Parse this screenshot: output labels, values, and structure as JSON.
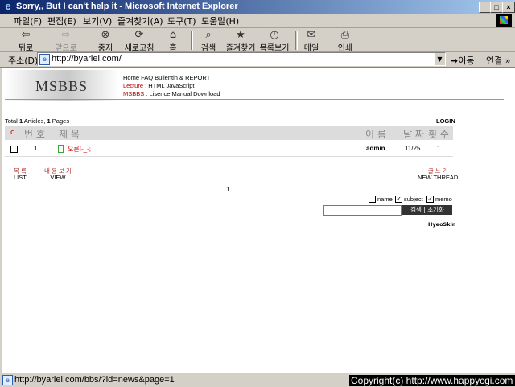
{
  "window": {
    "title": "Sorry,, But I can't help it - Microsoft Internet Explorer",
    "minimize": "_",
    "maximize": "□",
    "close": "×"
  },
  "menu": [
    "파일(F)",
    "편집(E)",
    "보기(V)",
    "즐겨찾기(A)",
    "도구(T)",
    "도움말(H)"
  ],
  "toolbar": {
    "back": "뒤로",
    "forward": "앞으로",
    "stop": "중지",
    "refresh": "새로고침",
    "home": "홈",
    "search": "검색",
    "favorites": "즐겨찾기",
    "history": "목록보기",
    "mail": "메일",
    "print": "인쇄"
  },
  "address": {
    "label": "주소(D)",
    "url": "http://byariel.com/",
    "go": "이동",
    "links": "연결 »"
  },
  "page": {
    "brand": "MSBBS",
    "nav1": "Home  FAQ  Bullentin & REPORT",
    "nav2_label": "Lecture :",
    "nav2": " HTML  JavaScript",
    "nav3_label": "MSBBS :",
    "nav3": " Lisence  Manual  Download",
    "total_pre": "Total ",
    "total_n": "1",
    "total_mid": " Articles, ",
    "pages_n": "1",
    "pages_post": " Pages",
    "login": "LOGIN",
    "headers": {
      "c": "c",
      "num": "번 호",
      "subject": "제 목",
      "name": "이 름",
      "date": "날 짜",
      "hits": "횟 수"
    },
    "row": {
      "num": "1",
      "subject": "오른!-_-;",
      "name": "admin",
      "date": "11/25",
      "hits": "1"
    },
    "list_k": "목 록",
    "list_e": "LIST",
    "view_k": "내 용 보 기",
    "view_e": "VIEW",
    "write_k": "글 쓰 기",
    "write_e": "NEW THREAD",
    "page_number": "1",
    "opt_name": "name",
    "opt_subject": "subject",
    "opt_memo": "memo",
    "search_btn": "검색  | 초기화",
    "skin": "HyeoSkin"
  },
  "status": {
    "text": "http://byariel.com/bbs/?id=news&page=1",
    "copyright": "Copyright(c) http://www.happycgi.com"
  }
}
